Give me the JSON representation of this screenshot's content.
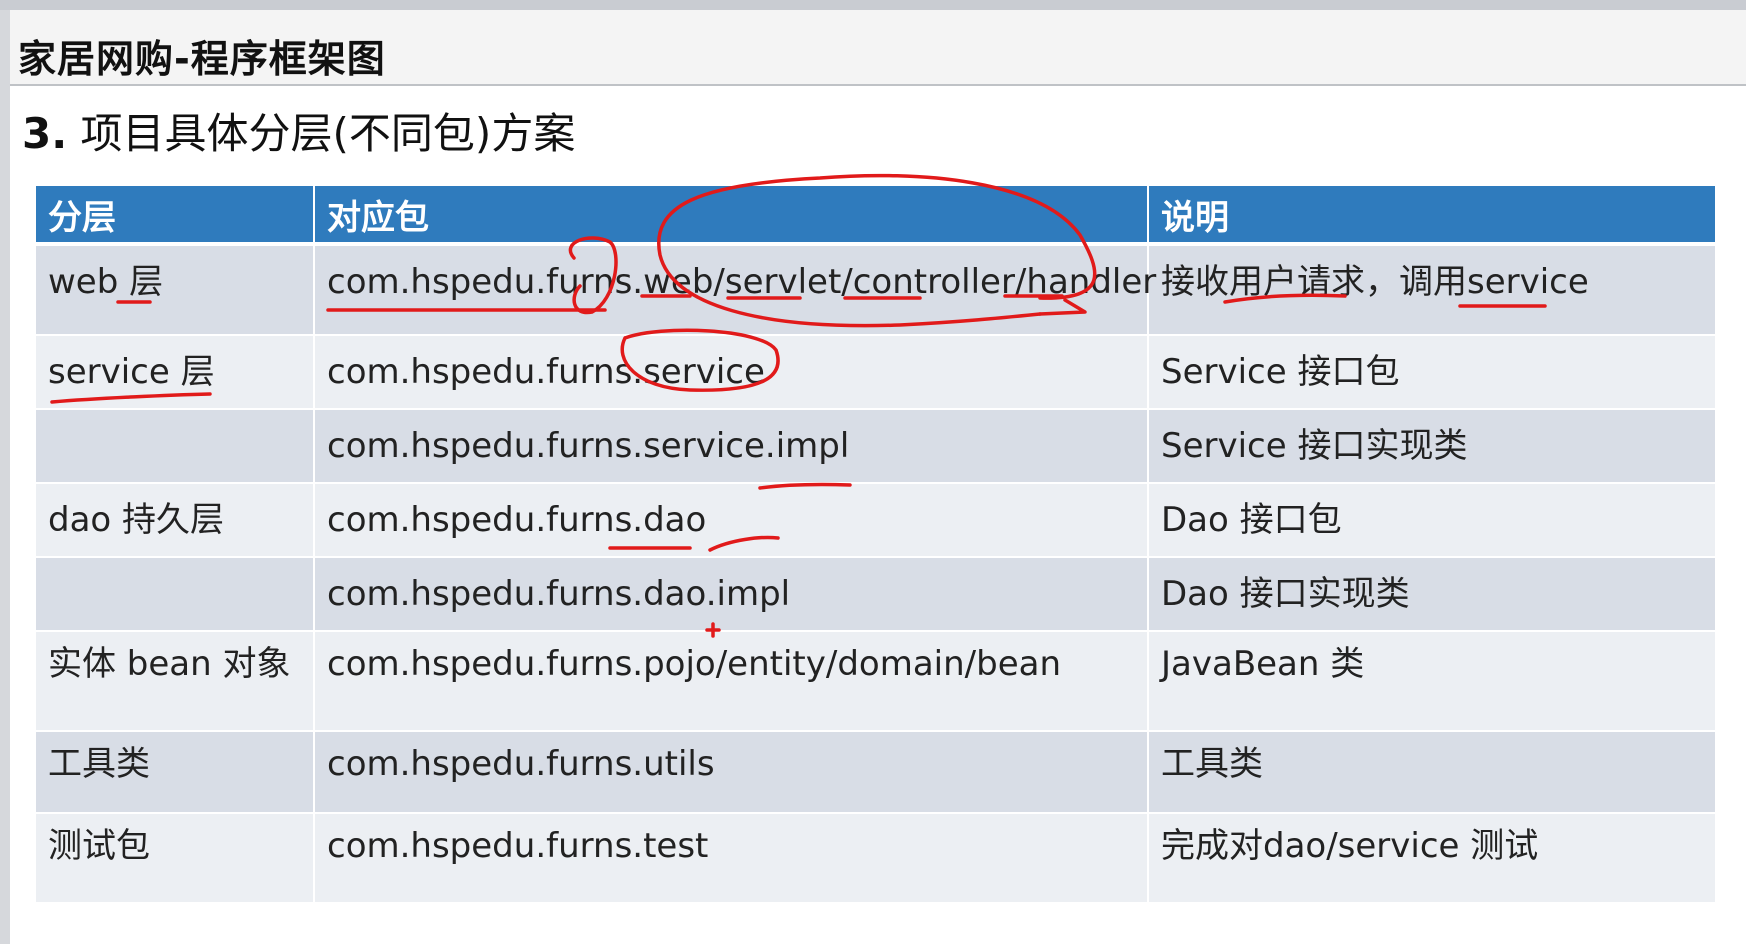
{
  "slide": {
    "title": "家居网购-程序框架图"
  },
  "heading": {
    "number": "3.",
    "text": "项目具体分层(不同包)方案"
  },
  "table": {
    "headers": [
      "分层",
      "对应包",
      "说明"
    ],
    "rows": [
      [
        "web 层",
        "com.hspedu.furns.web/servlet/controller/handler",
        "接收用户请求，调用service"
      ],
      [
        "service 层",
        "com.hspedu.furns.service",
        "Service 接口包"
      ],
      [
        "",
        "com.hspedu.furns.service.impl",
        "Service 接口实现类"
      ],
      [
        "dao 持久层",
        "com.hspedu.furns.dao",
        "Dao 接口包"
      ],
      [
        "",
        "com.hspedu.furns.dao.impl",
        "Dao 接口实现类"
      ],
      [
        "实体 bean 对象",
        "com.hspedu.furns.pojo/entity/domain/bean",
        "JavaBean 类"
      ],
      [
        "工具类",
        "com.hspedu.furns.utils",
        "工具类"
      ],
      [
        "测试包",
        "com.hspedu.furns.test",
        "完成对dao/service 测试"
      ]
    ]
  },
  "colors": {
    "header_bg": "#2f7bbd",
    "row_a": "#d8dde6",
    "row_b": "#eceff3",
    "annotation": "#e11a1a"
  }
}
